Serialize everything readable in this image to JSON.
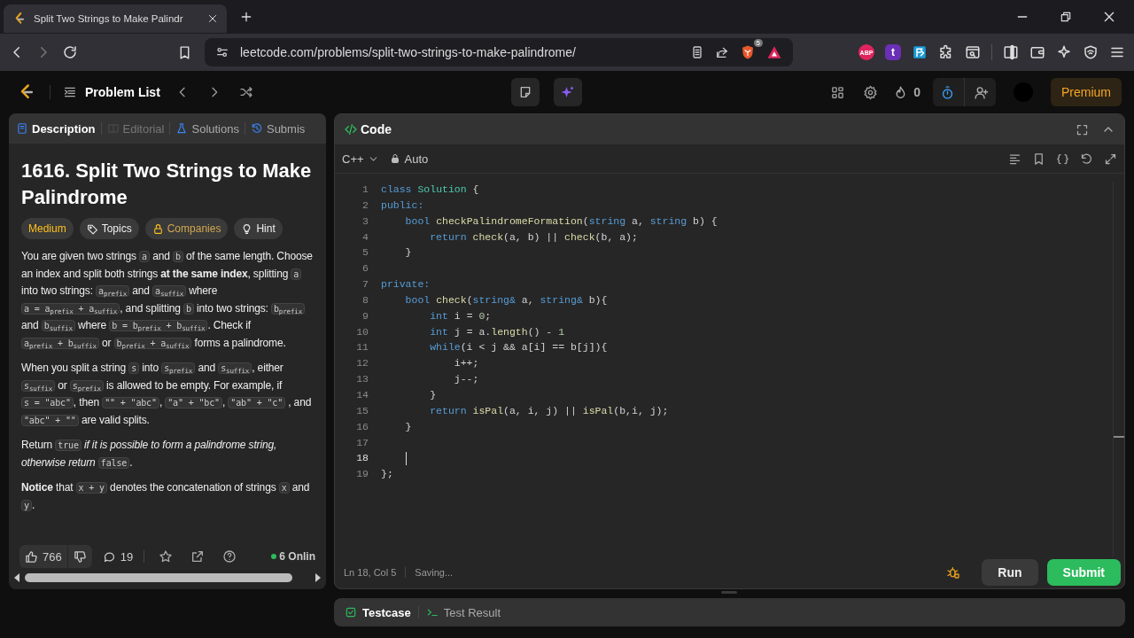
{
  "browser": {
    "tab_title": "Split Two Strings to Make Palindr",
    "url": "leetcode.com/problems/split-two-strings-to-make-palindrome/",
    "shield_badge": "5",
    "extensions": [
      {
        "kind": "abp",
        "label": "ABP"
      },
      {
        "kind": "letter",
        "label": "t"
      }
    ]
  },
  "nav": {
    "title": "Problem List",
    "streak": "0",
    "premium": "Premium"
  },
  "left_tabs": [
    {
      "kind": "description",
      "label": "Description",
      "selected": true,
      "disabled": false
    },
    {
      "kind": "editorial",
      "label": "Editorial",
      "selected": false,
      "disabled": true
    },
    {
      "kind": "solutions",
      "label": "Solutions",
      "selected": false,
      "disabled": false
    },
    {
      "kind": "submissions",
      "label": "Submis",
      "selected": false,
      "disabled": false
    }
  ],
  "problem": {
    "title": "1616. Split Two Strings to Make Palindrome",
    "tags": [
      {
        "kind": "difficulty",
        "label": "Medium"
      },
      {
        "kind": "topics",
        "label": "Topics"
      },
      {
        "kind": "companies",
        "label": "Companies"
      },
      {
        "kind": "hint",
        "label": "Hint"
      }
    ],
    "paragraphs": [
      [
        {
          "kind": "text",
          "text": "You are given two strings "
        },
        {
          "kind": "code",
          "text": "a"
        },
        {
          "kind": "text",
          "text": " and "
        },
        {
          "kind": "code",
          "text": "b"
        },
        {
          "kind": "text",
          "text": " of the same length. Choose an index and split both strings **at the same index**, splitting "
        },
        {
          "kind": "code",
          "text": "a"
        },
        {
          "kind": "text",
          "text": " into two strings: "
        },
        {
          "kind": "code",
          "text": "a$_{prefix}$"
        },
        {
          "kind": "text",
          "text": " and "
        },
        {
          "kind": "code",
          "text": "a$_{suffix}$"
        },
        {
          "kind": "text",
          "text": " where "
        },
        {
          "kind": "code",
          "text": "a = a$_{prefix}$ + a$_{suffix}$"
        },
        {
          "kind": "text",
          "text": ", and splitting "
        },
        {
          "kind": "code",
          "text": "b"
        },
        {
          "kind": "text",
          "text": " into two strings: "
        },
        {
          "kind": "code",
          "text": "b$_{prefix}$"
        },
        {
          "kind": "text",
          "text": " and "
        },
        {
          "kind": "code",
          "text": "b$_{suffix}$"
        },
        {
          "kind": "text",
          "text": " where "
        },
        {
          "kind": "code",
          "text": "b = b$_{prefix}$ + b$_{suffix}$"
        },
        {
          "kind": "text",
          "text": ". Check if "
        },
        {
          "kind": "code",
          "text": "a$_{prefix}$ + b$_{suffix}$"
        },
        {
          "kind": "text",
          "text": " or "
        },
        {
          "kind": "code",
          "text": "b$_{prefix}$ + a$_{suffix}$"
        },
        {
          "kind": "text",
          "text": " forms a palindrome."
        }
      ],
      [
        {
          "kind": "text",
          "text": "When you split a string "
        },
        {
          "kind": "code",
          "text": "s"
        },
        {
          "kind": "text",
          "text": " into "
        },
        {
          "kind": "code",
          "text": "s$_{prefix}$"
        },
        {
          "kind": "text",
          "text": " and "
        },
        {
          "kind": "code",
          "text": "s$_{suffix}$"
        },
        {
          "kind": "text",
          "text": ", either "
        },
        {
          "kind": "code",
          "text": "s$_{suffix}$"
        },
        {
          "kind": "text",
          "text": " or "
        },
        {
          "kind": "code",
          "text": "s$_{prefix}$"
        },
        {
          "kind": "text",
          "text": " is allowed to be empty. For example, if "
        },
        {
          "kind": "code",
          "text": "s = \"abc\""
        },
        {
          "kind": "text",
          "text": ", then "
        },
        {
          "kind": "code",
          "text": "\"\" + \"abc\""
        },
        {
          "kind": "text",
          "text": ", "
        },
        {
          "kind": "code",
          "text": "\"a\" + \"bc\""
        },
        {
          "kind": "text",
          "text": ", "
        },
        {
          "kind": "code",
          "text": "\"ab\" + \"c\""
        },
        {
          "kind": "text",
          "text": " , and "
        },
        {
          "kind": "code",
          "text": "\"abc\" + \"\""
        },
        {
          "kind": "text",
          "text": " are valid splits."
        }
      ],
      [
        {
          "kind": "text",
          "text": "Return "
        },
        {
          "kind": "code",
          "text": "true"
        },
        {
          "kind": "text",
          "text": " *if it is possible to form a palindrome string, otherwise return* "
        },
        {
          "kind": "code",
          "text": "false"
        },
        {
          "kind": "text",
          "text": "."
        }
      ],
      [
        {
          "kind": "text",
          "text": "**Notice** that "
        },
        {
          "kind": "code",
          "text": "x + y"
        },
        {
          "kind": "text",
          "text": " denotes the concatenation of strings "
        },
        {
          "kind": "code",
          "text": "x"
        },
        {
          "kind": "text",
          "text": " and "
        },
        {
          "kind": "code",
          "text": "y"
        },
        {
          "kind": "text",
          "text": "."
        }
      ]
    ]
  },
  "footer": {
    "likes": "766",
    "comments": "19",
    "online": "6 Onlin"
  },
  "editor": {
    "title": "Code",
    "language": "C++",
    "mode": "Auto",
    "status": "Ln 18, Col 5",
    "save_state": "Saving...",
    "buttons": [
      {
        "kind": "run",
        "label": "Run"
      },
      {
        "kind": "submit",
        "label": "Submit"
      }
    ],
    "lines": [
      {
        "number": "1",
        "cursor": false,
        "tokens": [
          {
            "kind": "kw",
            "text": "class "
          },
          {
            "kind": "type",
            "text": "Solution"
          },
          {
            "kind": "plain",
            "text": " {"
          }
        ]
      },
      {
        "number": "2",
        "cursor": false,
        "tokens": [
          {
            "kind": "kw",
            "text": "public:"
          }
        ]
      },
      {
        "number": "3",
        "cursor": false,
        "tokens": [
          {
            "kind": "kw",
            "text": "    bool "
          },
          {
            "kind": "fn",
            "text": "checkPalindromeFormation"
          },
          {
            "kind": "plain",
            "text": "("
          },
          {
            "kind": "kw",
            "text": "string"
          },
          {
            "kind": "plain",
            "text": " a, "
          },
          {
            "kind": "kw",
            "text": "string"
          },
          {
            "kind": "plain",
            "text": " b) {"
          }
        ]
      },
      {
        "number": "4",
        "cursor": false,
        "tokens": [
          {
            "kind": "kw",
            "text": "        return "
          },
          {
            "kind": "fn",
            "text": "check"
          },
          {
            "kind": "plain",
            "text": "(a, b) || "
          },
          {
            "kind": "fn",
            "text": "check"
          },
          {
            "kind": "plain",
            "text": "(b, a);"
          }
        ]
      },
      {
        "number": "5",
        "cursor": false,
        "tokens": [
          {
            "kind": "plain",
            "text": "    }"
          }
        ]
      },
      {
        "number": "6",
        "cursor": false
      },
      {
        "number": "7",
        "cursor": false,
        "tokens": [
          {
            "kind": "kw",
            "text": "private:"
          }
        ]
      },
      {
        "number": "8",
        "cursor": false,
        "tokens": [
          {
            "kind": "kw",
            "text": "    bool "
          },
          {
            "kind": "fn",
            "text": "check"
          },
          {
            "kind": "plain",
            "text": "("
          },
          {
            "kind": "kw",
            "text": "string&"
          },
          {
            "kind": "plain",
            "text": " a, "
          },
          {
            "kind": "kw",
            "text": "string&"
          },
          {
            "kind": "plain",
            "text": " b){"
          }
        ]
      },
      {
        "number": "9",
        "cursor": false,
        "tokens": [
          {
            "kind": "kw",
            "text": "        int"
          },
          {
            "kind": "plain",
            "text": " i = "
          },
          {
            "kind": "num",
            "text": "0"
          },
          {
            "kind": "plain",
            "text": ";"
          }
        ]
      },
      {
        "number": "10",
        "cursor": false,
        "tokens": [
          {
            "kind": "kw",
            "text": "        int"
          },
          {
            "kind": "plain",
            "text": " j = a."
          },
          {
            "kind": "fn",
            "text": "length"
          },
          {
            "kind": "plain",
            "text": "() - "
          },
          {
            "kind": "num",
            "text": "1"
          }
        ]
      },
      {
        "number": "11",
        "cursor": false,
        "tokens": [
          {
            "kind": "kw",
            "text": "        while"
          },
          {
            "kind": "plain",
            "text": "(i < j && a[i] == b[j]){"
          }
        ]
      },
      {
        "number": "12",
        "cursor": false,
        "tokens": [
          {
            "kind": "plain",
            "text": "            i++;"
          }
        ]
      },
      {
        "number": "13",
        "cursor": false,
        "tokens": [
          {
            "kind": "plain",
            "text": "            j--;"
          }
        ]
      },
      {
        "number": "14",
        "cursor": false,
        "tokens": [
          {
            "kind": "plain",
            "text": "        }"
          }
        ]
      },
      {
        "number": "15",
        "cursor": false,
        "tokens": [
          {
            "kind": "kw",
            "text": "        return "
          },
          {
            "kind": "fn",
            "text": "isPal"
          },
          {
            "kind": "plain",
            "text": "(a, i, j) || "
          },
          {
            "kind": "fn",
            "text": "isPal"
          },
          {
            "kind": "plain",
            "text": "(b,i, j);"
          }
        ]
      },
      {
        "number": "16",
        "cursor": false,
        "tokens": [
          {
            "kind": "plain",
            "text": "    }"
          }
        ]
      },
      {
        "number": "17",
        "cursor": false
      },
      {
        "number": "18",
        "cursor": true
      },
      {
        "number": "19",
        "cursor": false,
        "tokens": [
          {
            "kind": "plain",
            "text": "};"
          }
        ]
      }
    ]
  },
  "bottom_tabs": [
    {
      "kind": "testcase",
      "label": "Testcase",
      "selected": true
    },
    {
      "kind": "result",
      "label": "Test Result",
      "selected": false
    }
  ]
}
